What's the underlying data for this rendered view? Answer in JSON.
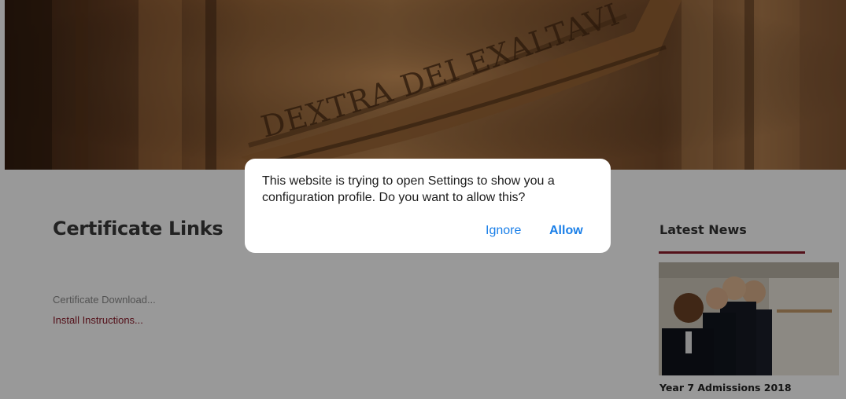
{
  "hero": {
    "carved_text": "DEXTRA DEI EXALTAVIT"
  },
  "certificate": {
    "title": "Certificate Links",
    "download_text": "Certificate Download...",
    "install_link": "Install Instructions..."
  },
  "news": {
    "title": "Latest News",
    "caption": "Year 7 Admissions 2018"
  },
  "dialog": {
    "message": "This website is trying to open Settings to show you a configuration profile. Do you want to allow this?",
    "ignore_label": "Ignore",
    "allow_label": "Allow"
  },
  "colors": {
    "accent": "#8d1d2c",
    "link_blue": "#1a7fe8",
    "overlay": "rgba(0,0,0,0.40)"
  }
}
